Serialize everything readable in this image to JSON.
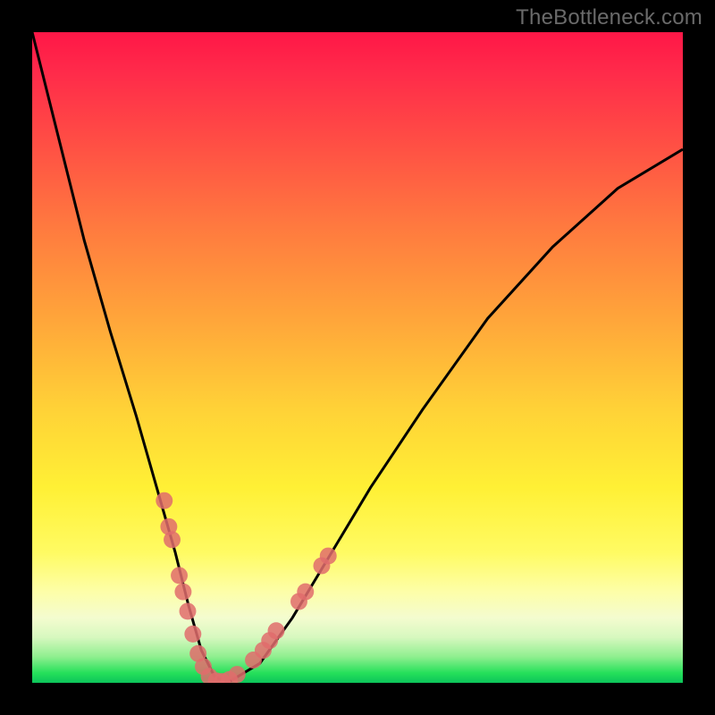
{
  "watermark": "TheBottleneck.com",
  "chart_data": {
    "type": "line",
    "title": "",
    "xlabel": "",
    "ylabel": "",
    "xlim": [
      0,
      100
    ],
    "ylim": [
      0,
      100
    ],
    "legend": false,
    "annotations": [],
    "curve": {
      "name": "bottleneck-curve",
      "color": "#000000",
      "x": [
        0,
        4,
        8,
        12,
        16,
        20,
        22,
        24,
        26,
        28,
        30,
        35,
        40,
        46,
        52,
        60,
        70,
        80,
        90,
        100
      ],
      "y": [
        100,
        84,
        68,
        54,
        41,
        27,
        20,
        12,
        5,
        1,
        0,
        3,
        10,
        20,
        30,
        42,
        56,
        67,
        76,
        82
      ]
    },
    "highlight_points": {
      "name": "data-points",
      "color": "#e06c6c",
      "radius": 1.3,
      "points": [
        {
          "x": 20.3,
          "y": 28.0
        },
        {
          "x": 21.0,
          "y": 24.0
        },
        {
          "x": 21.5,
          "y": 22.0
        },
        {
          "x": 22.6,
          "y": 16.5
        },
        {
          "x": 23.2,
          "y": 14.0
        },
        {
          "x": 23.9,
          "y": 11.0
        },
        {
          "x": 24.7,
          "y": 7.5
        },
        {
          "x": 25.5,
          "y": 4.5
        },
        {
          "x": 26.3,
          "y": 2.5
        },
        {
          "x": 27.2,
          "y": 1.0
        },
        {
          "x": 28.3,
          "y": 0.3
        },
        {
          "x": 29.2,
          "y": 0.2
        },
        {
          "x": 30.3,
          "y": 0.5
        },
        {
          "x": 31.5,
          "y": 1.3
        },
        {
          "x": 34.0,
          "y": 3.5
        },
        {
          "x": 35.5,
          "y": 5.0
        },
        {
          "x": 36.5,
          "y": 6.5
        },
        {
          "x": 37.5,
          "y": 8.0
        },
        {
          "x": 41.0,
          "y": 12.5
        },
        {
          "x": 42.0,
          "y": 14.0
        },
        {
          "x": 44.5,
          "y": 18.0
        },
        {
          "x": 45.5,
          "y": 19.5
        }
      ]
    },
    "gradient_bands": {
      "top_color": "#ff1747",
      "bottom_color": "#0cc45a",
      "green_start_y": 2.5
    }
  }
}
